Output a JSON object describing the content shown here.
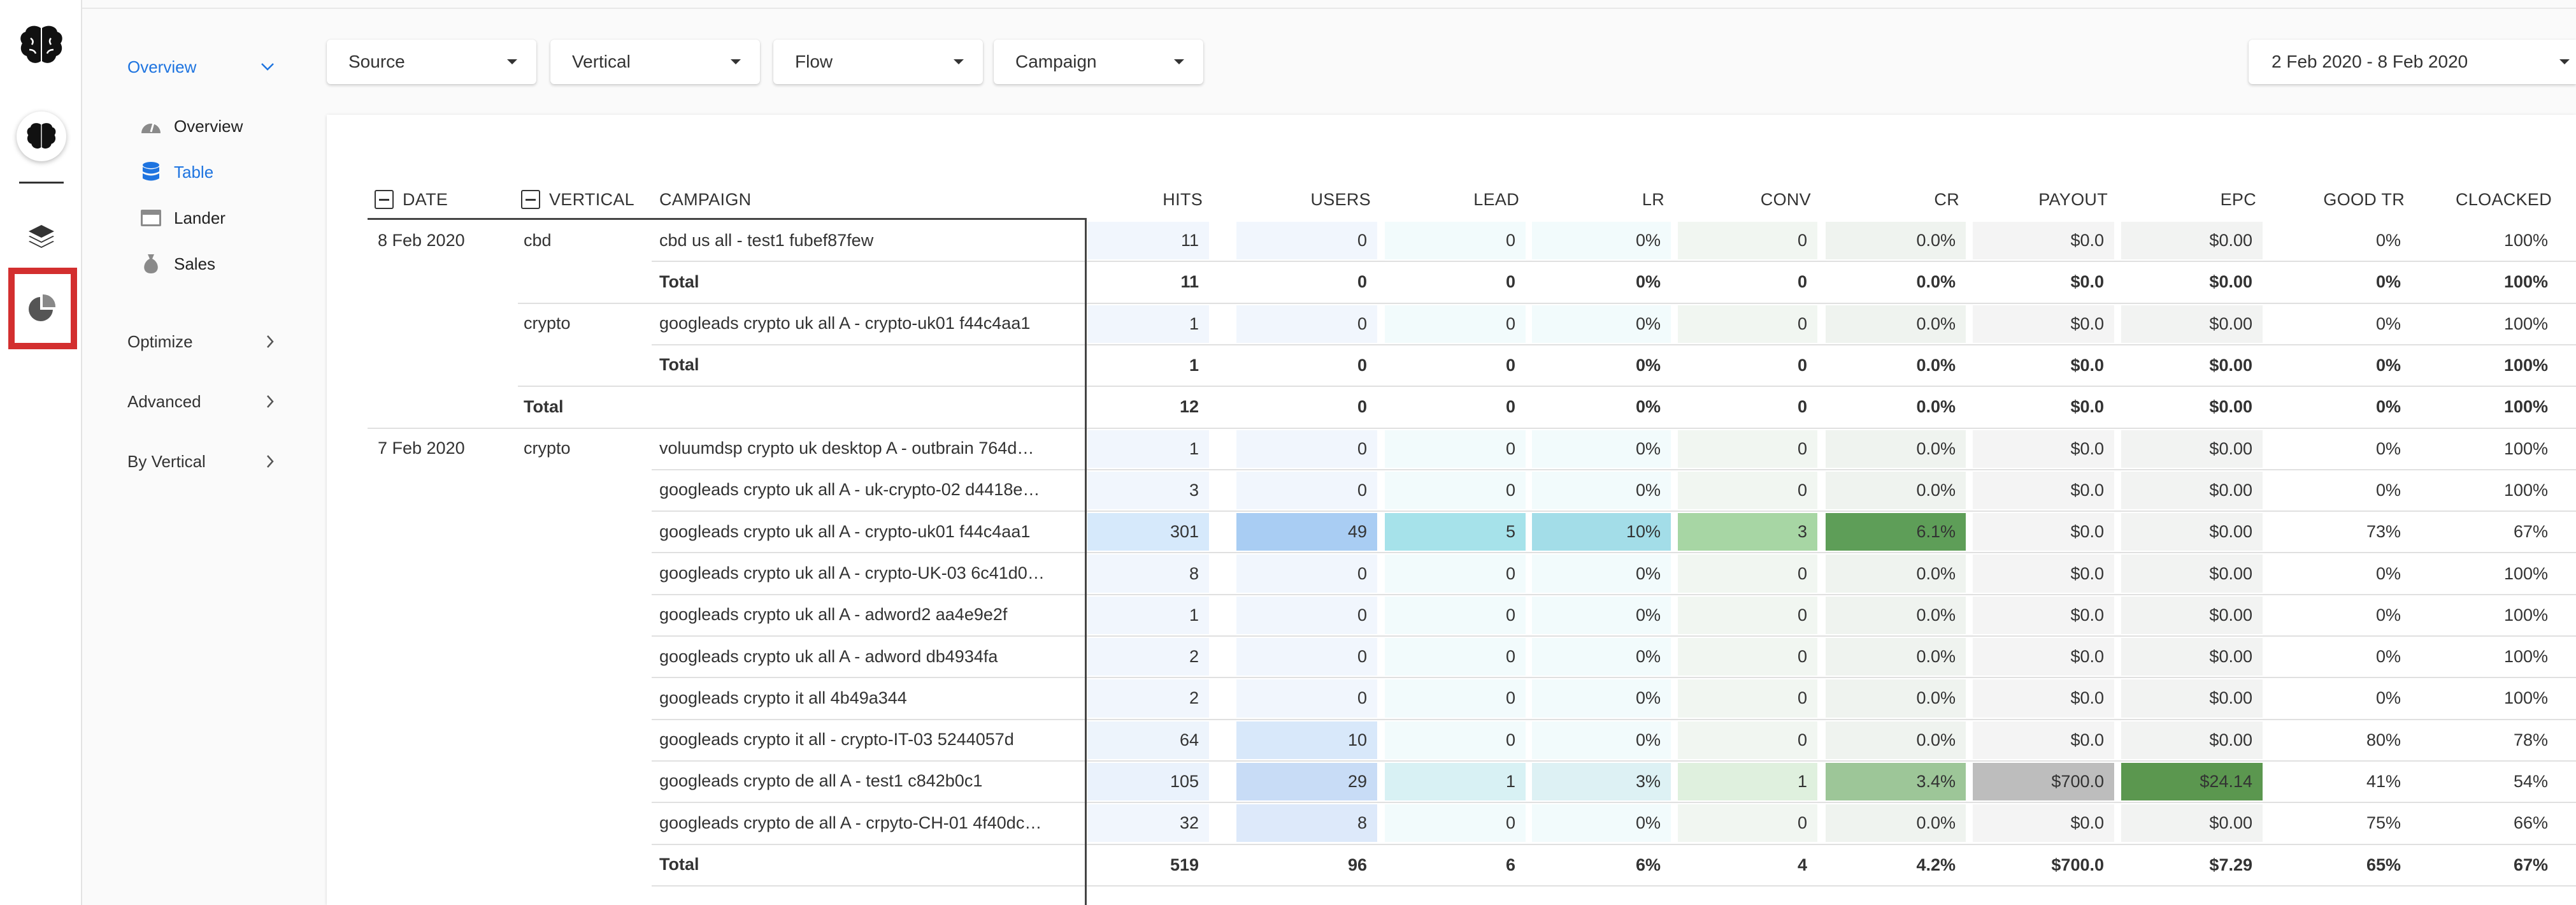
{
  "rail": {
    "icons": [
      "brain-logo-icon",
      "brain-icon",
      "layers-icon",
      "pie-chart-icon"
    ]
  },
  "sidebar": {
    "overview_label": "Overview",
    "sub_items": [
      {
        "label": "Overview",
        "icon": "gauge-icon"
      },
      {
        "label": "Table",
        "icon": "database-icon"
      },
      {
        "label": "Lander",
        "icon": "window-icon"
      },
      {
        "label": "Sales",
        "icon": "money-bag-icon"
      }
    ],
    "sections": [
      "Optimize",
      "Advanced",
      "By Vertical"
    ]
  },
  "filters": {
    "source": "Source",
    "vertical": "Vertical",
    "flow": "Flow",
    "campaign": "Campaign",
    "date_range": "2 Feb 2020 - 8 Feb 2020"
  },
  "table": {
    "columns": {
      "date": "DATE",
      "vertical": "VERTICAL",
      "campaign": "CAMPAIGN",
      "metrics": [
        "HITS",
        "USERS",
        "LEAD",
        "LR",
        "CONV",
        "CR",
        "PAYOUT",
        "EPC",
        "GOOD TR",
        "CLOACKED"
      ]
    },
    "rows": [
      {
        "date": "8 Feb 2020",
        "vertical": "cbd",
        "campaign": "cbd us all - test1 fubef87few",
        "kind": "data",
        "values": [
          "11",
          "0",
          "0",
          "0%",
          "0",
          "0.0%",
          "$0.0",
          "$0.00",
          "0%",
          "100%"
        ]
      },
      {
        "date": "",
        "vertical": "",
        "campaign": "Total",
        "kind": "sub",
        "values": [
          "11",
          "0",
          "0",
          "0%",
          "0",
          "0.0%",
          "$0.0",
          "$0.00",
          "0%",
          "100%"
        ]
      },
      {
        "date": "",
        "vertical": "crypto",
        "campaign": "googleads crypto uk all A - crypto-uk01 f44c4aa1",
        "kind": "data",
        "values": [
          "1",
          "0",
          "0",
          "0%",
          "0",
          "0.0%",
          "$0.0",
          "$0.00",
          "0%",
          "100%"
        ]
      },
      {
        "date": "",
        "vertical": "",
        "campaign": "Total",
        "kind": "sub",
        "values": [
          "1",
          "0",
          "0",
          "0%",
          "0",
          "0.0%",
          "$0.0",
          "$0.00",
          "0%",
          "100%"
        ]
      },
      {
        "date": "",
        "vertical": "Total",
        "campaign": "",
        "kind": "grand",
        "values": [
          "12",
          "0",
          "0",
          "0%",
          "0",
          "0.0%",
          "$0.0",
          "$0.00",
          "0%",
          "100%"
        ]
      },
      {
        "date": "7 Feb 2020",
        "vertical": "crypto",
        "campaign": "voluumdsp crypto uk desktop A - outbrain 764d…",
        "kind": "data",
        "values": [
          "1",
          "0",
          "0",
          "0%",
          "0",
          "0.0%",
          "$0.0",
          "$0.00",
          "0%",
          "100%"
        ]
      },
      {
        "date": "",
        "vertical": "",
        "campaign": "googleads crypto uk all A - uk-crypto-02 d4418e…",
        "kind": "data",
        "values": [
          "3",
          "0",
          "0",
          "0%",
          "0",
          "0.0%",
          "$0.0",
          "$0.00",
          "0%",
          "100%"
        ]
      },
      {
        "date": "",
        "vertical": "",
        "campaign": "googleads crypto uk all A - crypto-uk01 f44c4aa1",
        "kind": "data",
        "values": [
          "301",
          "49",
          "5",
          "10%",
          "3",
          "6.1%",
          "$0.0",
          "$0.00",
          "73%",
          "67%"
        ]
      },
      {
        "date": "",
        "vertical": "",
        "campaign": "googleads crypto uk all A - crypto-UK-03 6c41d0…",
        "kind": "data",
        "values": [
          "8",
          "0",
          "0",
          "0%",
          "0",
          "0.0%",
          "$0.0",
          "$0.00",
          "0%",
          "100%"
        ]
      },
      {
        "date": "",
        "vertical": "",
        "campaign": "googleads crypto uk all A - adword2 aa4e9e2f",
        "kind": "data",
        "values": [
          "1",
          "0",
          "0",
          "0%",
          "0",
          "0.0%",
          "$0.0",
          "$0.00",
          "0%",
          "100%"
        ]
      },
      {
        "date": "",
        "vertical": "",
        "campaign": "googleads crypto uk all A - adword db4934fa",
        "kind": "data",
        "values": [
          "2",
          "0",
          "0",
          "0%",
          "0",
          "0.0%",
          "$0.0",
          "$0.00",
          "0%",
          "100%"
        ]
      },
      {
        "date": "",
        "vertical": "",
        "campaign": "googleads crypto it all 4b49a344",
        "kind": "data",
        "values": [
          "2",
          "0",
          "0",
          "0%",
          "0",
          "0.0%",
          "$0.0",
          "$0.00",
          "0%",
          "100%"
        ]
      },
      {
        "date": "",
        "vertical": "",
        "campaign": "googleads crypto it all - crypto-IT-03 5244057d",
        "kind": "data",
        "values": [
          "64",
          "10",
          "0",
          "0%",
          "0",
          "0.0%",
          "$0.0",
          "$0.00",
          "80%",
          "78%"
        ]
      },
      {
        "date": "",
        "vertical": "",
        "campaign": "googleads crypto de all A - test1 c842b0c1",
        "kind": "data",
        "values": [
          "105",
          "29",
          "1",
          "3%",
          "1",
          "3.4%",
          "$700.0",
          "$24.14",
          "41%",
          "54%"
        ]
      },
      {
        "date": "",
        "vertical": "",
        "campaign": "googleads crypto de all A - crpyto-CH-01 4f40dc…",
        "kind": "data",
        "values": [
          "32",
          "8",
          "0",
          "0%",
          "0",
          "0.0%",
          "$0.0",
          "$0.00",
          "75%",
          "66%"
        ]
      },
      {
        "date": "",
        "vertical": "",
        "campaign": "Total",
        "kind": "sub",
        "values": [
          "519",
          "96",
          "6",
          "6%",
          "4",
          "4.2%",
          "$700.0",
          "$7.29",
          "65%",
          "67%"
        ]
      }
    ]
  }
}
